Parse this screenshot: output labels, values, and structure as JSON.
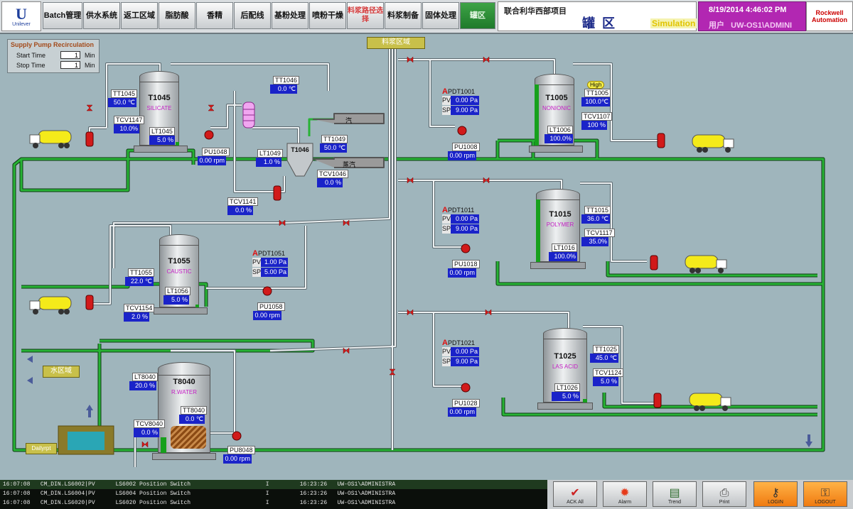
{
  "logo": {
    "text": "Unilever"
  },
  "nav": [
    {
      "label": "Batch管理"
    },
    {
      "label": "供水系统"
    },
    {
      "label": "返工区域"
    },
    {
      "label": "脂肪酸"
    },
    {
      "label": "香精"
    },
    {
      "label": "后配线"
    },
    {
      "label": "基粉处理"
    },
    {
      "label": "喷粉干燥"
    },
    {
      "label": "料浆路径选择"
    },
    {
      "label": "料浆制备"
    },
    {
      "label": "固体处理"
    },
    {
      "label": "罐区"
    }
  ],
  "header": {
    "project": "联合利华西部项目",
    "area": "罐区",
    "simulation": "Simulation",
    "datetime": "8/19/2014 4:46:02 PM",
    "user_label": "用户",
    "user": "UW-OS1\\ADMINI",
    "brand": "Rockwell Automation"
  },
  "recirc": {
    "title": "Supply Pump Recirculation",
    "start_label": "Start Time",
    "start_value": "1",
    "start_unit": "Min",
    "stop_label": "Stop Time",
    "stop_value": "1",
    "stop_unit": "Min"
  },
  "zones": {
    "slurry": "料浆区域",
    "water": "水区域",
    "dailyrpt": "Dailyrpt"
  },
  "steam_labels": {
    "a": "汽",
    "b": "蒸汽"
  },
  "tanks": {
    "t1045": {
      "name": "T1045",
      "sub": "SILICATE",
      "tt": "TT1045",
      "tt_val": "50.0 ℃",
      "tcv": "TCV1147",
      "tcv_val": "10.0%",
      "lt": "LT1045",
      "lt_val": "5.0 %",
      "pu": "PU1048",
      "pu_val": "0.00 rpm",
      "level": 0.05
    },
    "t1046": {
      "name": "T1046",
      "tt": "TT1046",
      "tt_val": "0.0 ℃",
      "lt": "LT1049",
      "lt_val": "1.0 %",
      "tt2": "TT1049",
      "tt2_val": "50.0 ℃",
      "tcv": "TCV1046",
      "tcv_val": "0.0 %",
      "tcv2": "TCV1141",
      "tcv2_val": "0.0 %"
    },
    "t1055": {
      "name": "T1055",
      "sub": "CAUSTIC",
      "tt": "TT1055",
      "tt_val": "22.0 ℃",
      "lt": "LT1056",
      "lt_val": "5.0 %",
      "tcv": "TCV1154",
      "tcv_val": "2.0 %",
      "pdt": "PDT1051",
      "pv": "1.00 Pa",
      "sp": "5.00 Pa",
      "pu": "PU1058",
      "pu_val": "0.00 rpm",
      "level": 0.05
    },
    "t8040": {
      "name": "T8040",
      "sub": "R.WATER",
      "lt": "LT8040",
      "lt_val": "20.0 %",
      "tt": "TT8040",
      "tt_val": "0.0 ℃",
      "tcv": "TCV8040",
      "tcv_val": "0.0 %",
      "pu": "PU8048",
      "pu_val": "0.00 rpm",
      "level": 0.2
    },
    "t1005": {
      "name": "T1005",
      "sub": "NONIONIC",
      "high": "High",
      "tt": "TT1005",
      "tt_val": "100.0℃",
      "tcv": "TCV1107",
      "tcv_val": "100 %",
      "lt": "LT1006",
      "lt_val": "100.0%",
      "pdt": "PDT1001",
      "pv": "0.00 Pa",
      "sp": "9.00 Pa",
      "pu": "PU1008",
      "pu_val": "0.00 rpm",
      "level": 1.0
    },
    "t1015": {
      "name": "T1015",
      "sub": "POLYMER",
      "tt": "TT1015",
      "tt_val": "36.0 ℃",
      "tcv": "TCV1117",
      "tcv_val": "35.0%",
      "lt": "LT1016",
      "lt_val": "100.0%",
      "pdt": "PDT1011",
      "pv": "0.00 Pa",
      "sp": "9.00 Pa",
      "pu": "PU1018",
      "pu_val": "0.00 rpm",
      "level": 1.0
    },
    "t1025": {
      "name": "T1025",
      "sub": "LAS ACID",
      "tt": "TT1025",
      "tt_val": "45.0 ℃",
      "tcv": "TCV1124",
      "tcv_val": "5.0 %",
      "lt": "LT1026",
      "lt_val": "5.0 %",
      "pdt": "PDT1021",
      "pv": "0.00 Pa",
      "sp": "9.00 Pa",
      "pu": "PU1028",
      "pu_val": "0.00 rpm",
      "level": 0.05
    }
  },
  "alarms": [
    {
      "time": "16:07:08",
      "tag": "CM_DIN.LS6002|PV",
      "desc": "LS6002 Position Switch",
      "flag": "I",
      "time2": "16:23:26",
      "user": "UW-OS1\\ADMINISTRA"
    },
    {
      "time": "16:07:08",
      "tag": "CM_DIN.LS6004|PV",
      "desc": "LS6004 Position Switch",
      "flag": "I",
      "time2": "16:23:26",
      "user": "UW-OS1\\ADMINISTRA"
    },
    {
      "time": "16:07:08",
      "tag": "CM_DIN.LS6020|PV",
      "desc": "LS6020 Position Switch",
      "flag": "I",
      "time2": "16:23:26",
      "user": "UW-OS1\\ADMINISTRA"
    }
  ],
  "bottom_buttons": [
    {
      "label": "ACK All",
      "icon": "ack-all-icon",
      "glyph": "✔"
    },
    {
      "label": "Alarm",
      "icon": "alarm-icon",
      "glyph": "✹"
    },
    {
      "label": "Trend",
      "icon": "trend-icon",
      "glyph": "▤"
    },
    {
      "label": "Print",
      "icon": "print-icon",
      "glyph": "⎙"
    },
    {
      "label": "LOGIN",
      "icon": "login-icon",
      "glyph": "⚷"
    },
    {
      "label": "LOGOUT",
      "icon": "logout-icon",
      "glyph": "⚿"
    }
  ],
  "colors": {
    "background": "#9fb5bc",
    "pipe_green": "#1f8a2a",
    "pipe_gray": "#eef2f3",
    "value_blue": "#1a23c9",
    "valve_red": "#d11a1a",
    "nav_active": "#2f9a3a",
    "header_magenta": "#b227b2"
  }
}
